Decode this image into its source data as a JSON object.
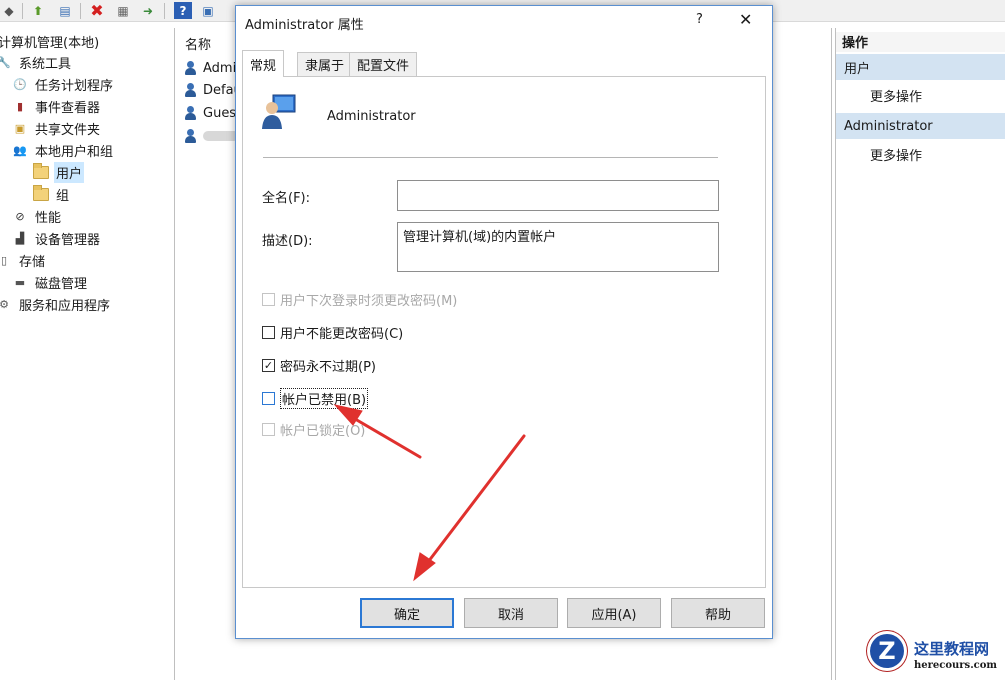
{
  "toolbar": {
    "icons": [
      "back-icon",
      "folder-up-icon",
      "show-hide-tree-icon",
      "delete-icon",
      "properties-icon",
      "export-icon",
      "help-icon",
      "console-icon"
    ]
  },
  "tree": {
    "root": "计算机管理(本地)",
    "items": [
      {
        "label": "系统工具",
        "icon": "tools-icon"
      },
      {
        "label": "任务计划程序",
        "icon": "clock-icon"
      },
      {
        "label": "事件查看器",
        "icon": "event-viewer-icon"
      },
      {
        "label": "共享文件夹",
        "icon": "shared-folder-icon"
      },
      {
        "label": "本地用户和组",
        "icon": "users-group-icon"
      },
      {
        "label": "用户",
        "icon": "folder-icon"
      },
      {
        "label": "组",
        "icon": "folder-icon"
      },
      {
        "label": "性能",
        "icon": "performance-icon"
      },
      {
        "label": "设备管理器",
        "icon": "device-manager-icon"
      },
      {
        "label": "存储",
        "icon": "storage-icon"
      },
      {
        "label": "磁盘管理",
        "icon": "disk-icon"
      },
      {
        "label": "服务和应用程序",
        "icon": "services-icon"
      }
    ]
  },
  "list": {
    "header": "名称",
    "rows": [
      "Admi",
      "Defau",
      "Gues",
      ""
    ]
  },
  "actions": {
    "title": "操作",
    "sections": [
      {
        "label": "用户",
        "item": "更多操作"
      },
      {
        "label": "Administrator",
        "item": "更多操作"
      }
    ]
  },
  "dialog": {
    "title": "Administrator 属性",
    "help": "?",
    "close": "✕",
    "tabs": [
      "常规",
      "隶属于",
      "配置文件"
    ],
    "account_name": "Administrator",
    "fullname_label": "全名(F):",
    "fullname_value": "",
    "description_label": "描述(D):",
    "description_value": "管理计算机(域)的内置帐户",
    "checkboxes": [
      {
        "label": "用户下次登录时须更改密码(M)",
        "checked": false,
        "enabled": false
      },
      {
        "label": "用户不能更改密码(C)",
        "checked": false,
        "enabled": true
      },
      {
        "label": "密码永不过期(P)",
        "checked": true,
        "enabled": true
      },
      {
        "label": "帐户已禁用(B)",
        "checked": false,
        "enabled": true
      },
      {
        "label": "帐户已锁定(O)",
        "checked": false,
        "enabled": false
      }
    ],
    "buttons": {
      "ok": "确定",
      "cancel": "取消",
      "apply": "应用(A)",
      "help": "帮助"
    }
  },
  "annotation": {
    "arrow_color": "#e0312e"
  },
  "watermark": {
    "cn": "这里教程网",
    "en": "herecours.com",
    "logo": "Z"
  }
}
